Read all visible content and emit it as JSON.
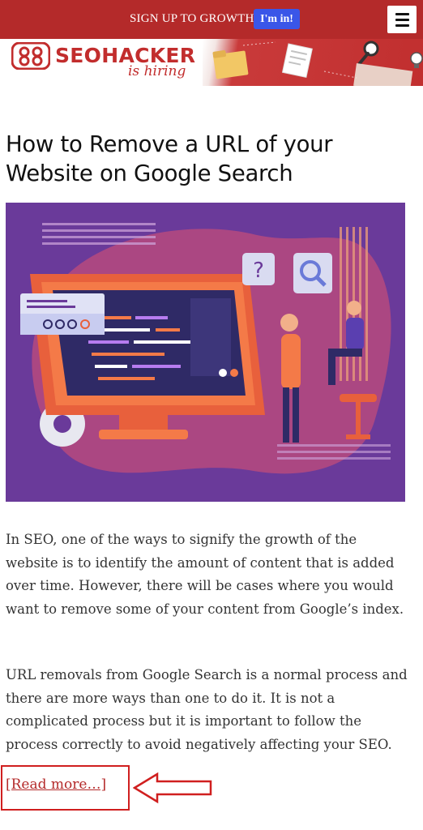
{
  "topbar": {
    "promo_text": "SIGN UP TO GROWTH",
    "cta_label": "I'm in!",
    "menu_icon": "hamburger-menu-icon"
  },
  "banner": {
    "logo_text": "SEOHACKER",
    "tagline": "is hiring",
    "brand_color": "#c22d2d"
  },
  "article": {
    "title": "How to Remove a URL of your Website on Google Search",
    "paragraphs": [
      "In SEO, one of the ways to signify the growth of the website is to identify the amount of content that is added over time. However, there will be cases where you would want to remove some of your content from Google’s index.",
      "URL removals from Google Search is a normal process and there are more ways than one to do it. It is not a complicated process but it is important to follow the process correctly to avoid negatively affecting your SEO."
    ],
    "read_more": "[Read more…]"
  },
  "colors": {
    "topbar": "#b42a2a",
    "cta": "#3a56e8",
    "hero_bg": "#6a3a9a",
    "annotation": "#d01f1f"
  }
}
